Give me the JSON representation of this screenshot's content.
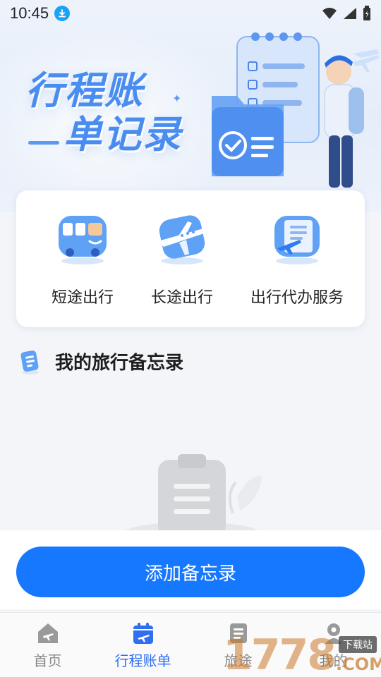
{
  "status_bar": {
    "time": "10:45",
    "icons": [
      "download-icon",
      "wifi-icon",
      "signal-icon",
      "battery-icon"
    ]
  },
  "hero": {
    "title_line1": "行程账",
    "title_line2": "单记录"
  },
  "services": [
    {
      "label": "短途出行",
      "icon": "bus-icon"
    },
    {
      "label": "长途出行",
      "icon": "airplane-icon"
    },
    {
      "label": "出行代办服务",
      "icon": "document-plane-icon"
    }
  ],
  "section": {
    "title": "我的旅行备忘录",
    "icon": "memo-icon"
  },
  "empty_state": {
    "icon": "clipboard-icon"
  },
  "add_button": {
    "label": "添加备忘录"
  },
  "tabbar": {
    "tabs": [
      {
        "label": "首页",
        "icon": "home-icon",
        "active": false
      },
      {
        "label": "行程账单",
        "icon": "calendar-plane-icon",
        "active": true
      },
      {
        "label": "旅途",
        "icon": "notes-icon",
        "active": false
      },
      {
        "label": "我的",
        "icon": "person-icon",
        "active": false
      }
    ]
  },
  "watermark": {
    "number": "1778",
    "tag": "下载站",
    "com": ".COM"
  },
  "colors": {
    "primary": "#1677ff",
    "tab_active": "#2f6ff0",
    "hero_title": "#4a8df0",
    "status_download": "#1aa3f5"
  }
}
